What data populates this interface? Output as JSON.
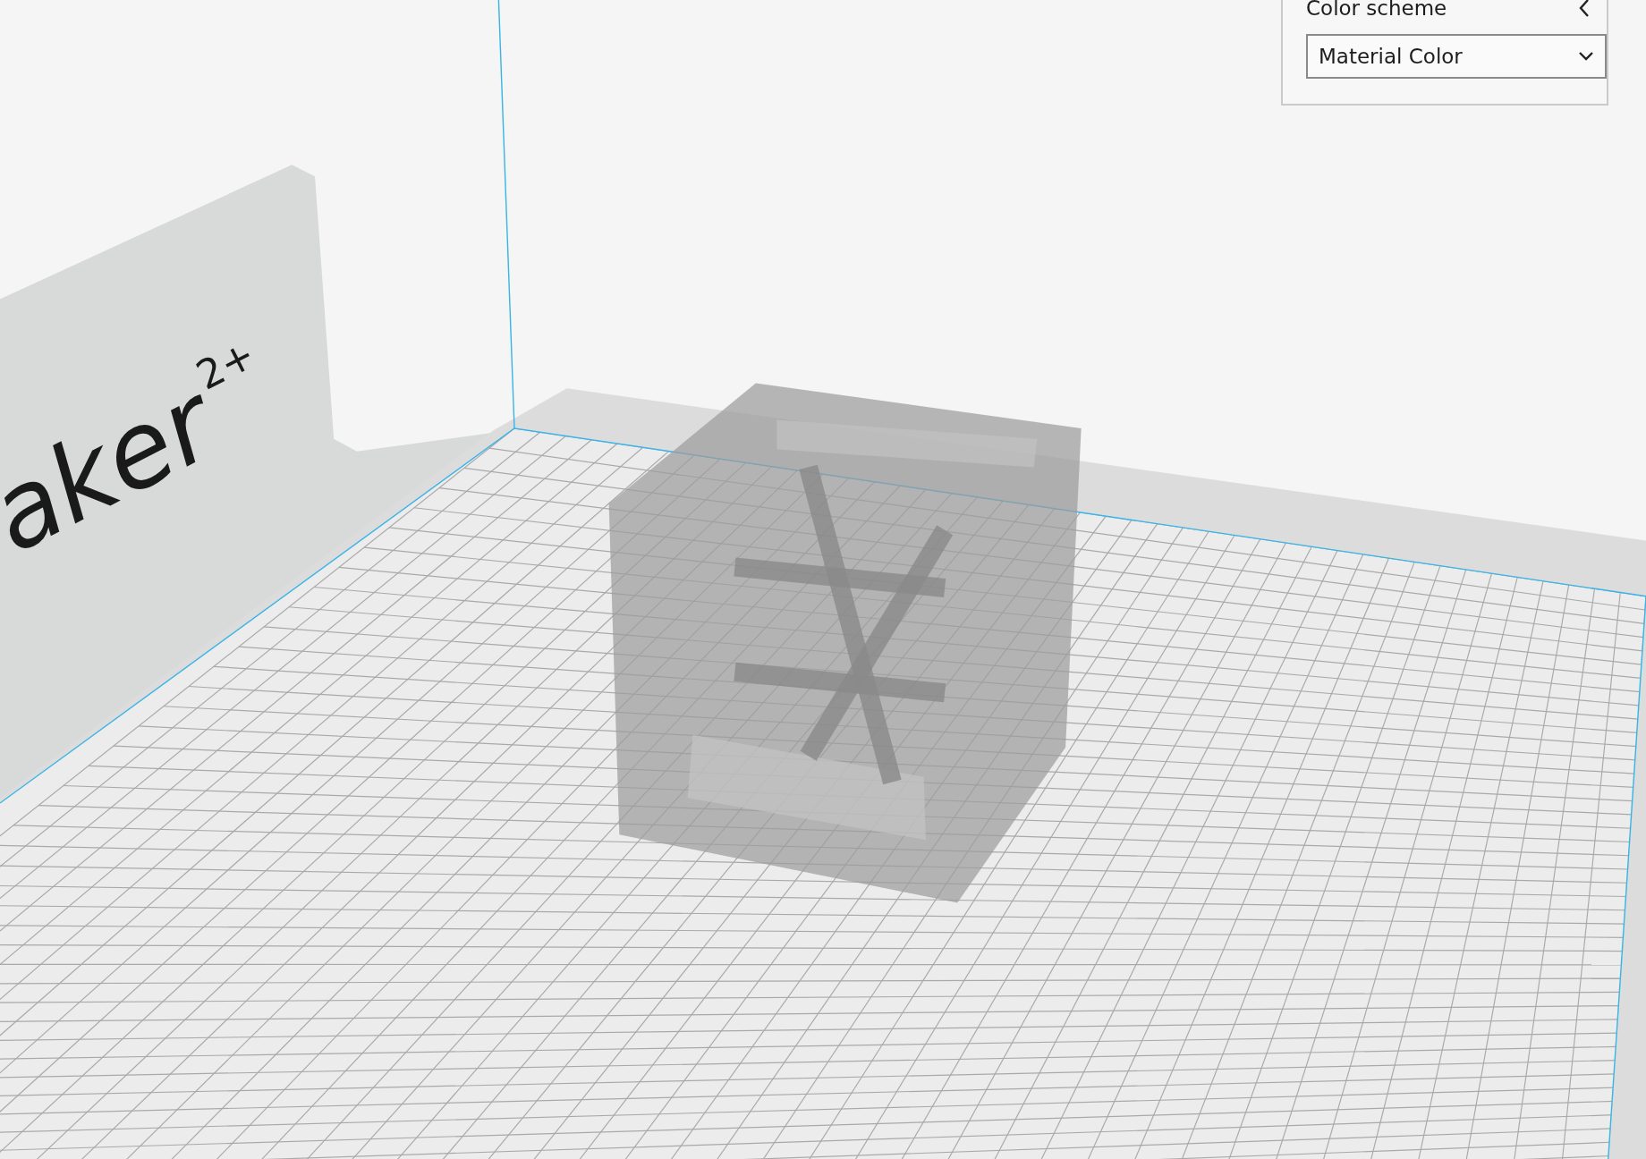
{
  "viewport": {
    "back_plate_logo": "aker",
    "back_plate_logo_superscript": "2+"
  },
  "view_panel": {
    "title": "Color scheme",
    "color_scheme_dropdown": {
      "value": "Material Color"
    }
  }
}
